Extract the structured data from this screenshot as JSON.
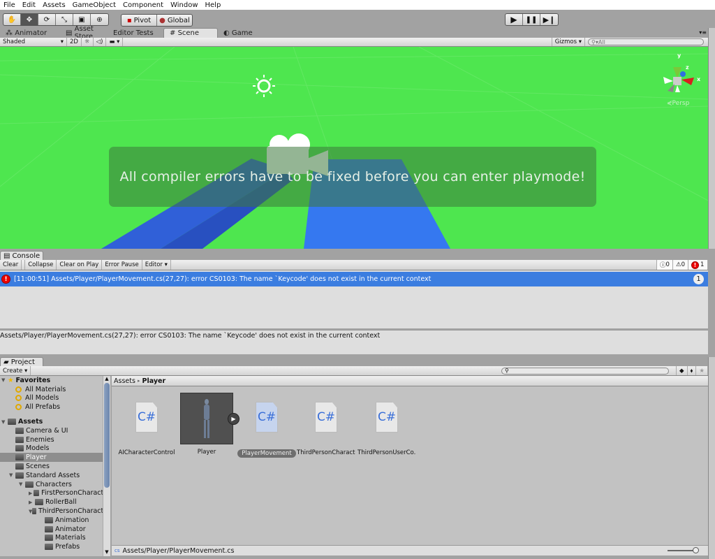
{
  "menu": [
    "File",
    "Edit",
    "Assets",
    "GameObject",
    "Component",
    "Window",
    "Help"
  ],
  "toolbar": {
    "tools": [
      "hand-tool",
      "move-tool",
      "rotate-tool",
      "scale-tool",
      "rect-tool",
      "transform-tool"
    ],
    "pivot": "Pivot",
    "global": "Global"
  },
  "tabs": [
    {
      "label": "Animator"
    },
    {
      "label": "Asset Store"
    },
    {
      "label": "Editor Tests"
    },
    {
      "label": "Scene"
    },
    {
      "label": "Game"
    }
  ],
  "scene_toolbar": {
    "shading": "Shaded",
    "mode2d": "2D",
    "gizmos": "Gizmos",
    "search_placeholder": "All"
  },
  "scene": {
    "persp": "Persp",
    "gizmo_axes": [
      "y",
      "z",
      "x"
    ],
    "message": "All compiler errors have to be fixed before you can enter playmode!"
  },
  "console": {
    "tab": "Console",
    "buttons": [
      "Clear",
      "Collapse",
      "Clear on Play",
      "Error Pause",
      "Editor"
    ],
    "counts": {
      "info": "0",
      "warning": "0",
      "error": "1"
    },
    "entry": {
      "text": "[11:00:51] Assets/Player/PlayerMovement.cs(27,27): error CS0103: The name `Keycode' does not exist in the current context",
      "count": "1"
    },
    "detail": "Assets/Player/PlayerMovement.cs(27,27): error CS0103: The name `Keycode' does not exist in the current context"
  },
  "project": {
    "tab": "Project",
    "create": "Create",
    "tree": [
      {
        "label": "Favorites",
        "level": 0,
        "type": "star",
        "expanded": true,
        "bold": true
      },
      {
        "label": "All Materials",
        "level": 1,
        "type": "search"
      },
      {
        "label": "All Models",
        "level": 1,
        "type": "search"
      },
      {
        "label": "All Prefabs",
        "level": 1,
        "type": "search"
      },
      {
        "label": "",
        "level": 0,
        "type": "spacer"
      },
      {
        "label": "Assets",
        "level": 0,
        "type": "folder",
        "expanded": true,
        "bold": true
      },
      {
        "label": "Camera & UI",
        "level": 1,
        "type": "folder"
      },
      {
        "label": "Enemies",
        "level": 1,
        "type": "folder"
      },
      {
        "label": "Models",
        "level": 1,
        "type": "folder"
      },
      {
        "label": "Player",
        "level": 1,
        "type": "folder",
        "selected": true
      },
      {
        "label": "Scenes",
        "level": 1,
        "type": "folder"
      },
      {
        "label": "Standard Assets",
        "level": 1,
        "type": "folder",
        "expanded": true
      },
      {
        "label": "Characters",
        "level": 2,
        "type": "folder",
        "expanded": true
      },
      {
        "label": "FirstPersonCharacter",
        "level": 3,
        "type": "folder",
        "collapsed": true
      },
      {
        "label": "RollerBall",
        "level": 3,
        "type": "folder",
        "collapsed": true
      },
      {
        "label": "ThirdPersonCharacter",
        "level": 3,
        "type": "folder",
        "expanded": true
      },
      {
        "label": "Animation",
        "level": 4,
        "type": "folder"
      },
      {
        "label": "Animator",
        "level": 4,
        "type": "folder"
      },
      {
        "label": "Materials",
        "level": 4,
        "type": "folder"
      },
      {
        "label": "Prefabs",
        "level": 4,
        "type": "folder"
      }
    ],
    "breadcrumb": [
      "Assets",
      "Player"
    ],
    "assets": [
      {
        "label": "AICharacterControl",
        "type": "script",
        "icon_text": "C#"
      },
      {
        "label": "Player",
        "type": "model"
      },
      {
        "label": "PlayerMovement",
        "type": "script",
        "icon_text": "C#",
        "selected": true
      },
      {
        "label": "ThirdPersonCharact...",
        "type": "script",
        "icon_text": "C#"
      },
      {
        "label": "ThirdPersonUserCo...",
        "type": "script",
        "icon_text": "C#"
      }
    ],
    "status_path": "Assets/Player/PlayerMovement.cs",
    "zoom_slider": 1.0
  }
}
